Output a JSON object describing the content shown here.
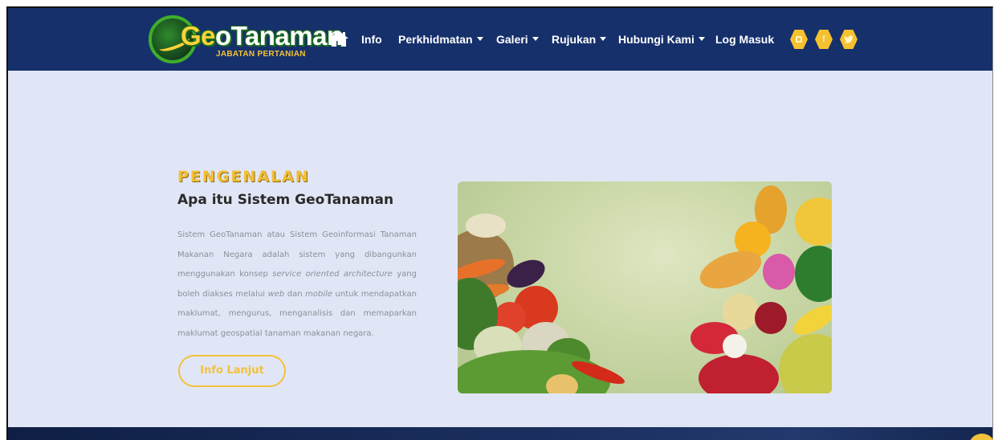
{
  "brand": {
    "prefix": "Ge",
    "name": "oTanaman",
    "subtitle": "JABATAN PERTANIAN"
  },
  "nav": {
    "home_icon": "home-icon",
    "items": [
      {
        "label": "Info",
        "dropdown": false
      },
      {
        "label": "Perkhidmatan",
        "dropdown": true
      },
      {
        "label": "Galeri",
        "dropdown": true
      },
      {
        "label": "Rujukan",
        "dropdown": true
      },
      {
        "label": "Hubungi Kami",
        "dropdown": true
      },
      {
        "label": "Log Masuk",
        "dropdown": false
      }
    ],
    "social_icons": [
      "instagram-icon",
      "facebook-icon",
      "twitter-icon"
    ]
  },
  "intro": {
    "kicker": "PENGENALAN",
    "heading": "Apa itu Sistem GeoTanaman",
    "para_parts": [
      "Sistem GeoTanaman atau Sistem Geoinformasi Tanaman Makanan Negara adalah sistem yang dibangunkan menggunakan konsep ",
      "service oriented architecture",
      " yang boleh diakses melalui ",
      "web",
      " dan ",
      "mobile",
      " untuk mendapatkan maklumat, mengurus, menganalisis dan memaparkan maklumat geospatial tanaman makanan negara."
    ],
    "button_label": "Info Lanjut"
  },
  "colors": {
    "navbar": "#16306b",
    "accent": "#f3c13a",
    "page_bg": "#e1e6f6"
  }
}
